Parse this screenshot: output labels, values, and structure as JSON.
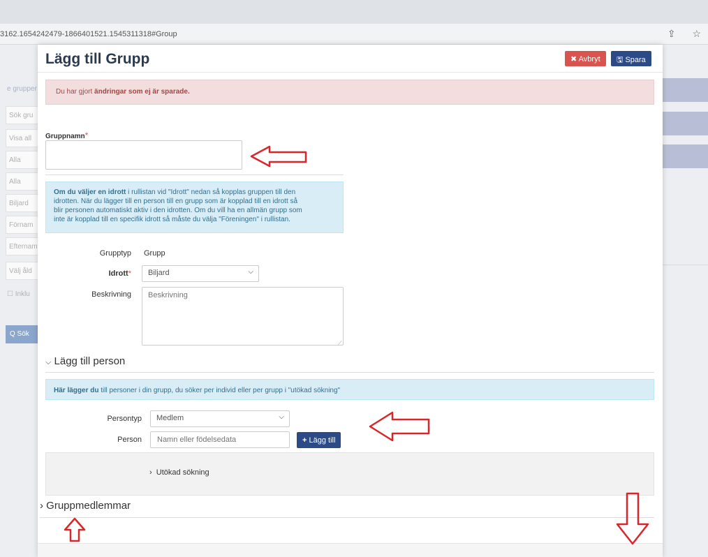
{
  "browser": {
    "url": "3162.1654242479-1866401521.1545311318#Group",
    "share_icon": "⇪",
    "star_icon": "☆"
  },
  "background": {
    "fields": [
      "e grupper",
      "Sök gru",
      "Visa all",
      "Alla",
      "Alla",
      "Biljard",
      "Förnam",
      "Efternam",
      "Välj åld"
    ],
    "include_checkbox_label": "Inklu",
    "search_button": "Q Sök"
  },
  "modal": {
    "title": "Lägg till Grupp",
    "cancel_label": "Avbryt",
    "save_label": "Spara",
    "unsaved_alert": {
      "prefix": "Du har gjort",
      "bold": "ändringar som ej är sparade."
    },
    "group_name": {
      "label": "Gruppnamn",
      "required_mark": "*",
      "value": ""
    },
    "info": {
      "bold": "Om du väljer en idrott",
      "line1": " i rullistan vid \"Idrott\" nedan så kopplas gruppen till den",
      "line2": "idrotten. När du lägger till en person till en grupp som är kopplad till en idrott så",
      "line3": "blir personen automatiskt aktiv i den idrotten. Om du vill ha en allmän grupp som",
      "line4": "inte är kopplad till en specifik idrott så måste du välja \"Föreningen\" i rullistan."
    },
    "group_type": {
      "label": "Grupptyp",
      "value": "Grupp"
    },
    "sport": {
      "label": "Idrott",
      "required_mark": "*",
      "selected": "Biljard"
    },
    "description": {
      "label": "Beskrivning",
      "placeholder": "Beskrivning"
    },
    "add_person": {
      "title": "Lägg till person",
      "info_bold": "Här lägger du",
      "info_text": " till personer i din grupp, du söker per individ eller per grupp i \"utökad sökning\"",
      "person_type": {
        "label": "Persontyp",
        "selected": "Medlem"
      },
      "person": {
        "label": "Person",
        "placeholder": "Namn eller födelsedata"
      },
      "add_button": "Lägg till",
      "extended_search": "Utökad sökning"
    },
    "group_members_title": "Gruppmedlemmar"
  },
  "colors": {
    "danger": "#d9534f",
    "primary": "#2c4a85",
    "annotation_arrow": "#d9262b"
  }
}
